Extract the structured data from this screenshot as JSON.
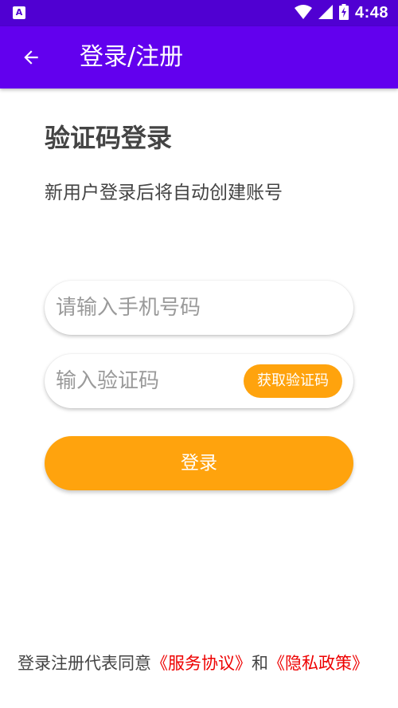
{
  "status_bar": {
    "left_icon": "A",
    "time": "4:48",
    "icons": [
      "wifi-icon",
      "cellular-signal-icon",
      "battery-charging-icon"
    ]
  },
  "app_bar": {
    "back_icon": "arrow-left-icon",
    "title": "登录/注册"
  },
  "login": {
    "heading": "验证码登录",
    "subtitle": "新用户登录后将自动创建账号",
    "phone_placeholder": "请输入手机号码",
    "code_placeholder": "输入验证码",
    "get_code_label": "获取验证码",
    "submit_label": "登录"
  },
  "agreement": {
    "prefix": "登录注册代表同意",
    "service_link": "《服务协议》",
    "connector": "和",
    "privacy_link": "《隐私政策》"
  },
  "colors": {
    "status_bar": "#5000d2",
    "app_bar": "#6200ee",
    "accent": "#ffa30d",
    "link": "#ee0000"
  }
}
